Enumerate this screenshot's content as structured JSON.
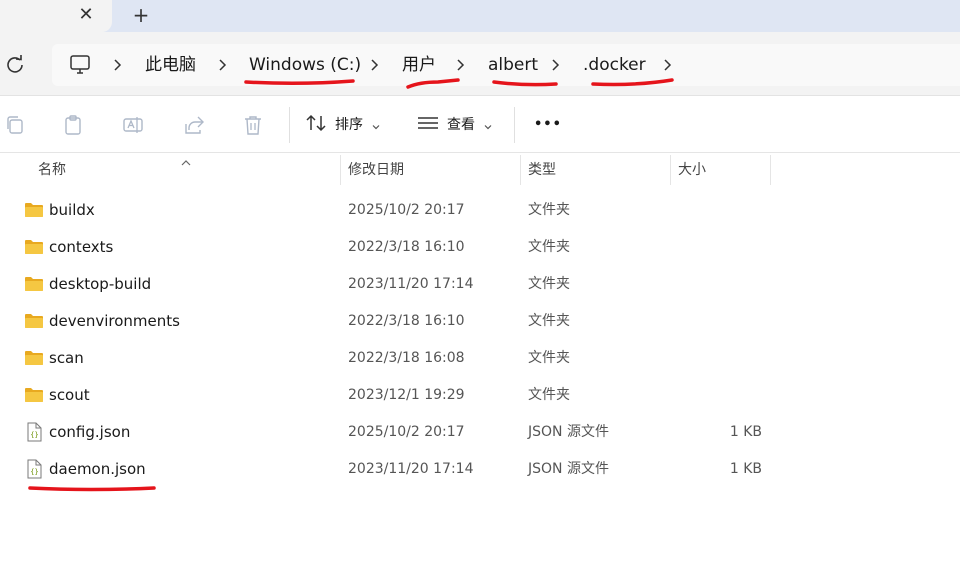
{
  "tabs": {
    "close_glyph": "✕",
    "new_glyph": "+"
  },
  "address": {
    "crumbs": [
      "此电脑",
      "Windows (C:)",
      "用户",
      "albert",
      ".docker"
    ],
    "highlighted": [
      "Windows (C:)",
      "用户",
      "albert",
      ".docker"
    ]
  },
  "toolbar": {
    "sort_label": "排序",
    "view_label": "查看",
    "more_label": "•••"
  },
  "columns": {
    "name": "名称",
    "modified": "修改日期",
    "type": "类型",
    "size": "大小"
  },
  "files": [
    {
      "name": "buildx",
      "modified": "2025/10/2 20:17",
      "type": "文件夹",
      "size": "",
      "kind": "folder"
    },
    {
      "name": "contexts",
      "modified": "2022/3/18 16:10",
      "type": "文件夹",
      "size": "",
      "kind": "folder"
    },
    {
      "name": "desktop-build",
      "modified": "2023/11/20 17:14",
      "type": "文件夹",
      "size": "",
      "kind": "folder"
    },
    {
      "name": "devenvironments",
      "modified": "2022/3/18 16:10",
      "type": "文件夹",
      "size": "",
      "kind": "folder"
    },
    {
      "name": "scan",
      "modified": "2022/3/18 16:08",
      "type": "文件夹",
      "size": "",
      "kind": "folder"
    },
    {
      "name": "scout",
      "modified": "2023/12/1 19:29",
      "type": "文件夹",
      "size": "",
      "kind": "folder"
    },
    {
      "name": "config.json",
      "modified": "2025/10/2 20:17",
      "type": "JSON 源文件",
      "size": "1 KB",
      "kind": "json"
    },
    {
      "name": "daemon.json",
      "modified": "2023/11/20 17:14",
      "type": "JSON 源文件",
      "size": "1 KB",
      "kind": "json",
      "highlighted": true
    }
  ],
  "colors": {
    "annotation_red": "#e5141b",
    "folder_yellow": "#f5c742",
    "folder_dark": "#e8a920",
    "tabstrip_bg": "#dfe6f3"
  }
}
